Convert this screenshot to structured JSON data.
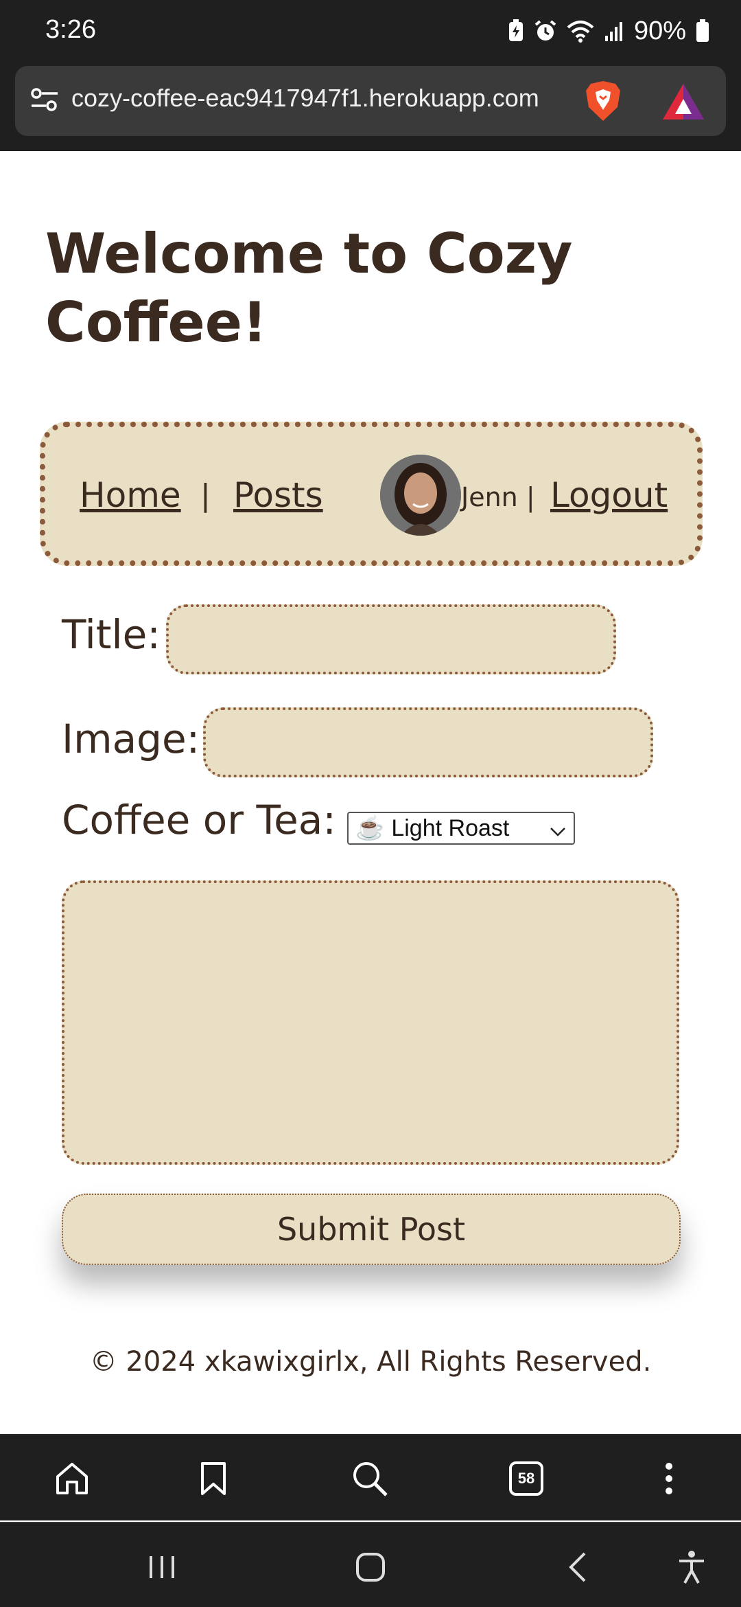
{
  "status_bar": {
    "time": "3:26",
    "battery": "90%",
    "icons": [
      "battery-saver-icon",
      "alarm-icon",
      "wifi-icon",
      "signal-icon",
      "battery-icon"
    ]
  },
  "browser": {
    "url": "cozy-coffee-eac9417947f1.herokuapp.com",
    "tab_count": "58"
  },
  "page": {
    "title": "Welcome to Cozy Coffee!",
    "nav": {
      "home": "Home",
      "separator": "|",
      "posts": "Posts",
      "user_name": "Jenn",
      "user_separator": "|",
      "logout": "Logout"
    },
    "form": {
      "title_label": "Title:",
      "title_value": "",
      "image_label": "Image:",
      "image_value": "",
      "type_label": "Coffee or Tea:",
      "type_selected_icon": "☕",
      "type_selected": "Light Roast",
      "body_value": "",
      "submit_label": "Submit Post"
    },
    "footer": "© 2024 xkawixgirlx, All Rights Reserved."
  },
  "colors": {
    "accent_bg": "#e8dfc5",
    "accent_border": "#8a5a3a",
    "text": "#3b2a20",
    "chrome": "#1f1f1f"
  }
}
